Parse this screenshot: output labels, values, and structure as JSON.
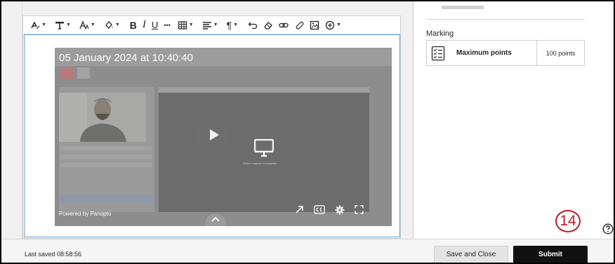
{
  "toolbar": {
    "items": [
      "text-style-icon",
      "paragraph-format-icon",
      "font-size-icon",
      "text-color-icon",
      "bold-icon",
      "italic-icon",
      "underline-icon",
      "more-icon",
      "table-icon",
      "align-icon",
      "paragraph-icon",
      "undo-icon",
      "clear-format-icon",
      "link-icon",
      "attach-icon",
      "image-icon",
      "insert-icon"
    ],
    "bold": "B",
    "italic": "I",
    "underline": "U",
    "more": "•••",
    "paragraph": "¶"
  },
  "video": {
    "timestamp": "05 January 2024 at 10:40:40",
    "powered_by": "Powered by Panopto",
    "capture_text": "Screen capture in progress"
  },
  "side": {
    "marking_label": "Marking",
    "marking_name": "Maximum points",
    "marking_value": "100 points"
  },
  "step_badge": "14",
  "footer": {
    "last_saved": "Last saved 08:58:56",
    "save_close": "Save and Close",
    "submit": "Submit"
  },
  "colors": {
    "accent_red": "#c01b2a",
    "editor_focus": "#5aa4d8",
    "submit_bg": "#111111"
  }
}
